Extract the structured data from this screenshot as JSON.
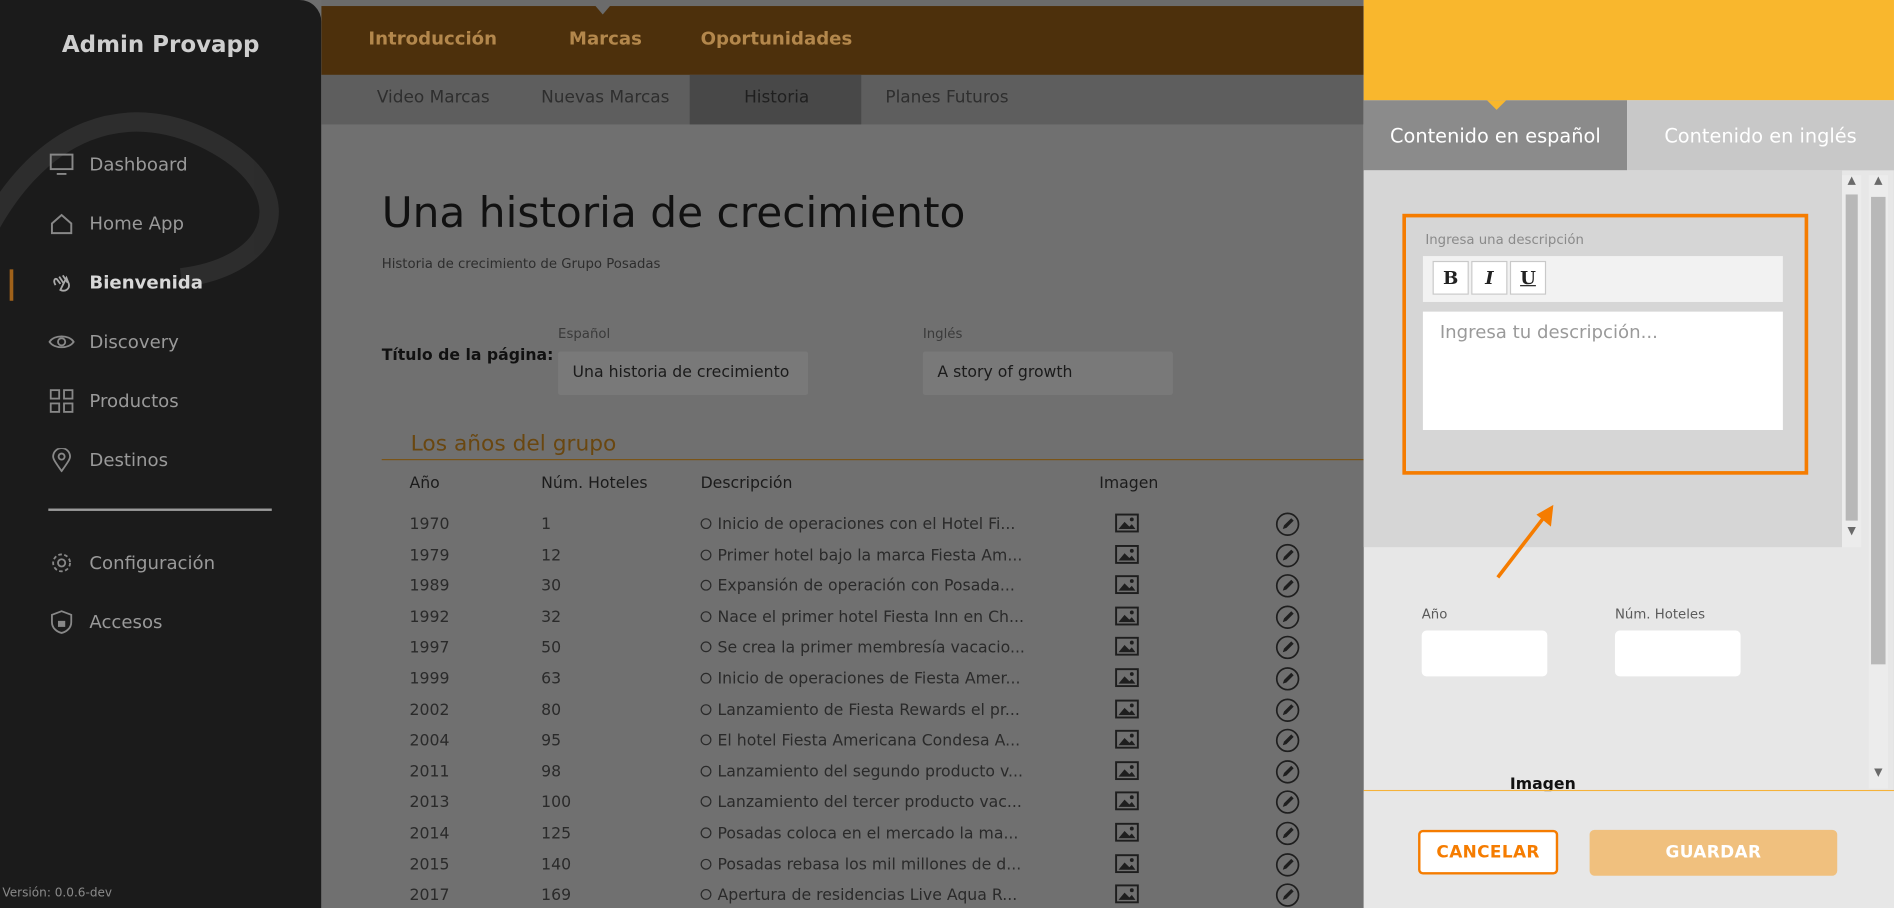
{
  "sidebar": {
    "brand": "Admin Provapp",
    "items": [
      {
        "label": "Dashboard",
        "icon": "monitor-icon"
      },
      {
        "label": "Home App",
        "icon": "home-icon"
      },
      {
        "label": "Bienvenida",
        "icon": "waving-hand-icon",
        "active": true
      },
      {
        "label": "Discovery",
        "icon": "eye-icon"
      },
      {
        "label": "Productos",
        "icon": "grid-icon"
      },
      {
        "label": "Destinos",
        "icon": "map-pin-icon"
      }
    ],
    "bottom_items": [
      {
        "label": "Configuración",
        "icon": "gear-icon"
      },
      {
        "label": "Accesos",
        "icon": "shield-lock-icon"
      }
    ],
    "version": "Versión: 0.0.6-dev"
  },
  "topnav": {
    "tabs": [
      "Introducción",
      "Marcas",
      "Oportunidades"
    ],
    "active": "Marcas"
  },
  "subnav": {
    "tabs": [
      "Video Marcas",
      "Nuevas Marcas",
      "Historia",
      "Planes Futuros"
    ],
    "active": "Historia"
  },
  "page": {
    "title": "Una historia de crecimiento",
    "subtitle": "Historia de crecimiento de Grupo Posadas",
    "page_title_label": "Título de la página:",
    "lang_es_label": "Español",
    "lang_en_label": "Inglés",
    "title_es_value": "Una historia de crecimiento",
    "title_en_value": "A story of growth"
  },
  "years": {
    "section_title": "Los años del grupo",
    "columns": [
      "Año",
      "Núm. Hoteles",
      "Descripción",
      "Imagen"
    ],
    "rows": [
      {
        "year": "1970",
        "hotels": "1",
        "desc": "Inicio de operaciones con el Hotel Fi..."
      },
      {
        "year": "1979",
        "hotels": "12",
        "desc": "Primer hotel bajo la marca Fiesta Am..."
      },
      {
        "year": "1989",
        "hotels": "30",
        "desc": "Expansión de operación con Posada..."
      },
      {
        "year": "1992",
        "hotels": "32",
        "desc": "Nace el primer hotel Fiesta Inn en Ch..."
      },
      {
        "year": "1997",
        "hotels": "50",
        "desc": "Se crea la primer membresía vacacio..."
      },
      {
        "year": "1999",
        "hotels": "63",
        "desc": "Inicio de operaciones de Fiesta Amer..."
      },
      {
        "year": "2002",
        "hotels": "80",
        "desc": "Lanzamiento de Fiesta Rewards el pr..."
      },
      {
        "year": "2004",
        "hotels": "95",
        "desc": "El hotel Fiesta Americana Condesa A..."
      },
      {
        "year": "2011",
        "hotels": "98",
        "desc": "Lanzamiento del segundo producto v..."
      },
      {
        "year": "2013",
        "hotels": "100",
        "desc": "Lanzamiento del tercer producto vac..."
      },
      {
        "year": "2014",
        "hotels": "125",
        "desc": "Posadas coloca en el mercado la ma..."
      },
      {
        "year": "2015",
        "hotels": "140",
        "desc": "Posadas rebasa los mil millones de d..."
      },
      {
        "year": "2017",
        "hotels": "169",
        "desc": "Apertura de residencias Live Aqua R..."
      }
    ]
  },
  "panel": {
    "tab_es": "Contenido en español",
    "tab_en": "Contenido en inglés",
    "desc_label": "Ingresa una descripción",
    "bold": "B",
    "italic": "I",
    "underline": "U",
    "desc_placeholder": "Ingresa tu descripción...",
    "year_label": "Año",
    "hotels_label": "Núm. Hoteles",
    "image_label": "Imagen",
    "cancel": "CANCELAR",
    "save": "GUARDAR"
  },
  "colors": {
    "accent": "#f9b72d",
    "highlight": "#f57c00",
    "sidebar": "#1b1b1b"
  }
}
